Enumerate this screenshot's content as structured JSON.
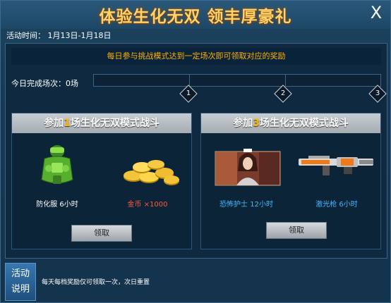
{
  "title": "体验生化无双  领丰厚豪礼",
  "close_glyph": "X",
  "activity_time": "活动时间：  1月13日-1月18日",
  "notice": "每日参与挑战模式达到一定场次即可领取对应的奖励",
  "progress": {
    "label": "今日完成场次：0场",
    "completed": 0,
    "max": 3,
    "milestones": [
      "1",
      "2",
      "3"
    ]
  },
  "cards": [
    {
      "header_prefix": "参加",
      "header_count": "1",
      "header_suffix": "场生化无双模式战斗",
      "rewards": [
        {
          "label": "防化服 6小时",
          "icon": "hazmat-suit-icon",
          "color": "#ffffff"
        },
        {
          "label": "金币  ×1000",
          "icon": "gold-coins-icon",
          "color": "#ff5a3c"
        }
      ],
      "claim": "领取"
    },
    {
      "header_prefix": "参加",
      "header_count": "3",
      "header_suffix": "场生化无双模式战斗",
      "rewards": [
        {
          "label": "恐怖护士 12小时",
          "icon": "nurse-character-icon",
          "color": "#44b7ff"
        },
        {
          "label": "激光枪 6小时",
          "icon": "laser-gun-icon",
          "color": "#44b7ff"
        }
      ],
      "claim": "领取"
    }
  ],
  "info_button": {
    "line1": "活动",
    "line2": "说明"
  },
  "reset_note": "每天每档奖励仅可领取一次，次日重置"
}
